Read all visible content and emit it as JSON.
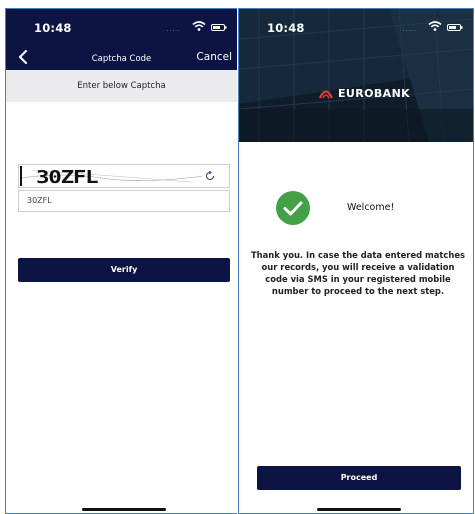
{
  "left_screen": {
    "status": {
      "time": "10:48",
      "signal": "....."
    },
    "nav": {
      "title": "Captcha Code",
      "cancel_label": "Cancel"
    },
    "prompt": "Enter below Captcha",
    "captcha": {
      "image_text": "30ZFL",
      "input_value": "30ZFL"
    },
    "verify_label": "Verify"
  },
  "right_screen": {
    "status": {
      "time": "10:48",
      "signal": "....."
    },
    "brand": "EUROBANK",
    "welcome": "Welcome!",
    "message": "Thank you. In case the data entered matches our records, you will receive a validation code via SMS in your registered mobile number to proceed to the next step.",
    "proceed_label": "Proceed"
  },
  "colors": {
    "navy": "#0c1444",
    "success_green": "#43a047",
    "brand_red": "#e53935",
    "frame_blue": "#3a86c8"
  }
}
